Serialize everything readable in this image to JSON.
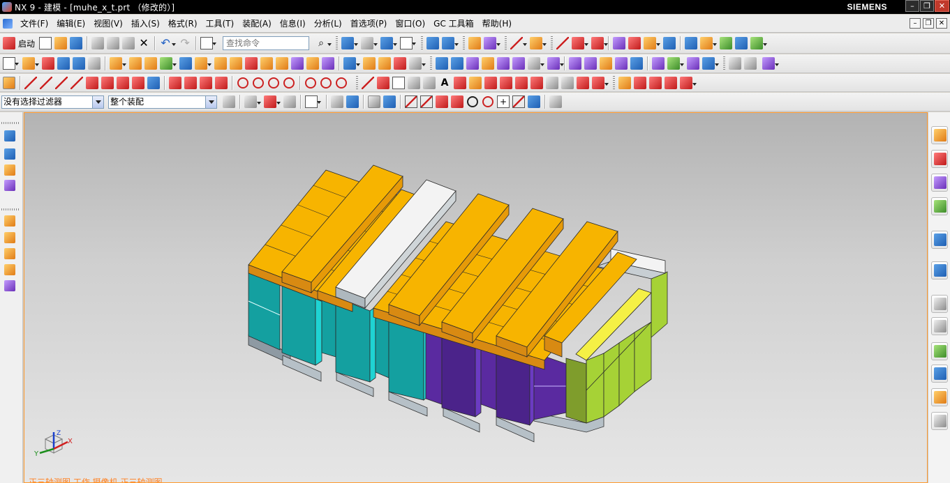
{
  "window": {
    "title": "NX 9 - 建模 - [muhe_x_t.prt （修改的）]",
    "brand": "SIEMENS",
    "controls": {
      "minimize": "–",
      "maximize": "❐",
      "close": "✕"
    }
  },
  "menubar": {
    "items": [
      "文件(F)",
      "编辑(E)",
      "视图(V)",
      "插入(S)",
      "格式(R)",
      "工具(T)",
      "装配(A)",
      "信息(I)",
      "分析(L)",
      "首选项(P)",
      "窗口(O)",
      "GC 工具箱",
      "帮助(H)"
    ],
    "mdi_controls": {
      "minimize": "–",
      "restore": "❐",
      "close": "✕"
    }
  },
  "toolbar": {
    "start_label": "启动",
    "search_placeholder": "查找命令"
  },
  "selection_bar": {
    "filter_value": "没有选择过滤器",
    "scope_value": "整个装配"
  },
  "viewport": {
    "status_text": "正三轴测图 工作 摄像机 正三轴测图",
    "triad_labels": {
      "x": "X",
      "y": "Y",
      "z": "Z"
    }
  },
  "colors": {
    "titlebar": "#000000",
    "viewport_border": "#ff9a2e",
    "view_label": "#ff7f1f",
    "part_orange": "#f7b400",
    "part_teal": "#14a0a0",
    "part_purple": "#5a2aa0",
    "part_green": "#a6d236",
    "part_white": "#f3f3f3",
    "part_yellow": "#f5f045"
  }
}
